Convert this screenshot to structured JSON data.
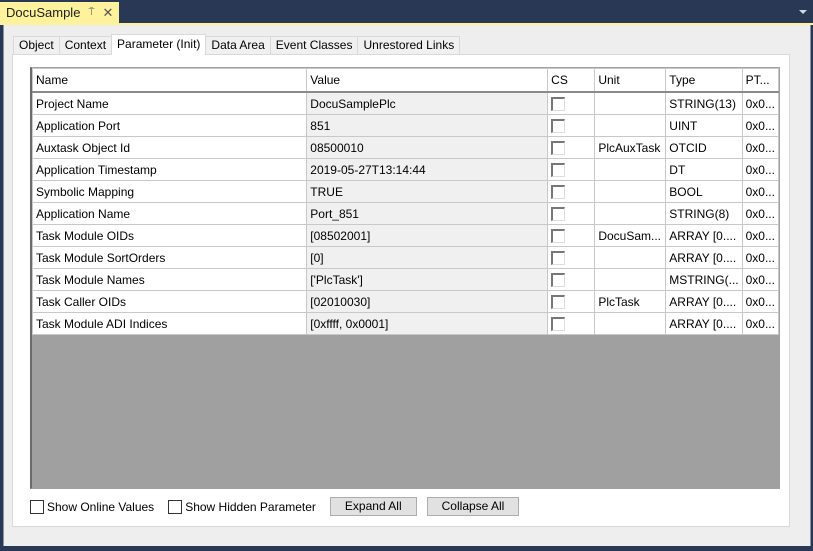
{
  "document_tab": {
    "title": "DocuSample",
    "pin_icon": "pin-icon",
    "close_icon": "close-icon"
  },
  "tabs": [
    {
      "label": "Object",
      "active": false
    },
    {
      "label": "Context",
      "active": false
    },
    {
      "label": "Parameter (Init)",
      "active": true
    },
    {
      "label": "Data Area",
      "active": false
    },
    {
      "label": "Event Classes",
      "active": false
    },
    {
      "label": "Unrestored Links",
      "active": false
    }
  ],
  "table": {
    "columns": [
      "Name",
      "Value",
      "CS",
      "Unit",
      "Type",
      "PT..."
    ],
    "rows": [
      {
        "name": "Project Name",
        "value": "DocuSamplePlc",
        "cs": false,
        "unit": "",
        "type": "STRING(13)",
        "pt": "0x0..."
      },
      {
        "name": "Application Port",
        "value": "851",
        "cs": false,
        "unit": "",
        "type": "UINT",
        "pt": "0x0..."
      },
      {
        "name": "Auxtask Object Id",
        "value": "08500010",
        "cs": false,
        "unit": "PlcAuxTask",
        "type": "OTCID",
        "pt": "0x0..."
      },
      {
        "name": "Application Timestamp",
        "value": "2019-05-27T13:14:44",
        "cs": false,
        "unit": "",
        "type": "DT",
        "pt": "0x0..."
      },
      {
        "name": "Symbolic Mapping",
        "value": "TRUE",
        "cs": false,
        "unit": "",
        "type": "BOOL",
        "pt": "0x0..."
      },
      {
        "name": "Application Name",
        "value": "Port_851",
        "cs": false,
        "unit": "",
        "type": "STRING(8)",
        "pt": "0x0..."
      },
      {
        "name": "Task Module OIDs",
        "value": "[08502001]",
        "cs": false,
        "unit": "DocuSam...",
        "type": "ARRAY [0....",
        "pt": "0x0..."
      },
      {
        "name": "Task Module SortOrders",
        "value": "[0]",
        "cs": false,
        "unit": "",
        "type": "ARRAY [0....",
        "pt": "0x0..."
      },
      {
        "name": "Task Module Names",
        "value": "['PlcTask']",
        "cs": false,
        "unit": "",
        "type": "MSTRING(...",
        "pt": "0x0..."
      },
      {
        "name": "Task Caller OIDs",
        "value": "[02010030]",
        "cs": false,
        "unit": "PlcTask",
        "type": "ARRAY [0....",
        "pt": "0x0..."
      },
      {
        "name": "Task Module ADI Indices",
        "value": "[0xffff, 0x0001]",
        "cs": false,
        "unit": "",
        "type": "ARRAY [0....",
        "pt": "0x0..."
      }
    ]
  },
  "footer": {
    "show_online_values": {
      "label": "Show Online Values",
      "checked": false
    },
    "show_hidden_parameter": {
      "label": "Show Hidden Parameter",
      "checked": false
    },
    "expand_all": "Expand All",
    "collapse_all": "Collapse All"
  }
}
